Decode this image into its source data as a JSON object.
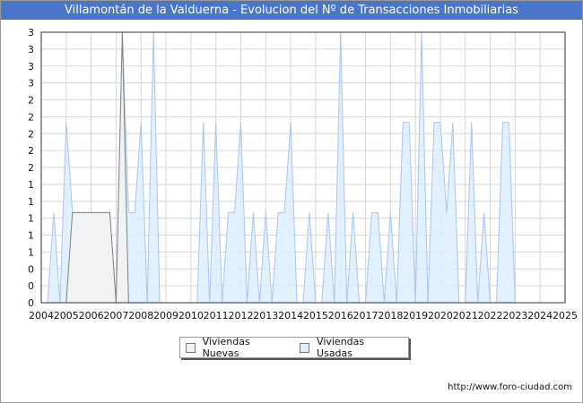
{
  "title": "Villamontán de la Valduerna - Evolucion del Nº de Transacciones Inmobiliarias",
  "footer": "http://www.foro-ciudad.com",
  "legend": {
    "nuevas_label": "Viviendas Nuevas",
    "usadas_label": "Viviendas Usadas"
  },
  "colors": {
    "title_bg": "#4a76c9",
    "nuevas_fill": "#f2f2f2",
    "nuevas_line": "#808080",
    "usadas_fill": "#ddeeff",
    "usadas_line": "#a9c4ee",
    "grid": "#d6d6d6"
  },
  "chart_data": {
    "type": "area",
    "title": "Villamontán de la Valduerna - Evolucion del Nº de Transacciones Inmobiliarias",
    "xlabel": "",
    "ylabel": "",
    "grid": true,
    "legend_position": "bottom-center",
    "xlim": [
      2004,
      2025
    ],
    "ylim": [
      0,
      3
    ],
    "x_ticks": [
      "2004",
      "2005",
      "2006",
      "2007",
      "2008",
      "2009",
      "2010",
      "2011",
      "2012",
      "2013",
      "2014",
      "2015",
      "2016",
      "2017",
      "2018",
      "2019",
      "2020",
      "2021",
      "2022",
      "2023",
      "2024",
      "2025"
    ],
    "y_ticks": [
      "0",
      "0",
      "0",
      "1",
      "1",
      "1",
      "1",
      "1",
      "2",
      "2",
      "2",
      "2",
      "2",
      "3",
      "3",
      "3",
      "3"
    ],
    "x": [
      2004,
      2004.25,
      2004.5,
      2004.75,
      2005,
      2005.25,
      2005.5,
      2005.75,
      2006,
      2006.25,
      2006.5,
      2006.75,
      2007,
      2007.25,
      2007.5,
      2007.75,
      2008,
      2008.25,
      2008.5,
      2008.75,
      2009,
      2009.25,
      2009.5,
      2009.75,
      2010,
      2010.25,
      2010.5,
      2010.75,
      2011,
      2011.25,
      2011.5,
      2011.75,
      2012,
      2012.25,
      2012.5,
      2012.75,
      2013,
      2013.25,
      2013.5,
      2013.75,
      2014,
      2014.25,
      2014.5,
      2014.75,
      2015,
      2015.25,
      2015.5,
      2015.75,
      2016,
      2016.25,
      2016.5,
      2016.75,
      2017,
      2017.25,
      2017.5,
      2017.75,
      2018,
      2018.25,
      2018.5,
      2018.75,
      2019,
      2019.25,
      2019.5,
      2019.75,
      2020,
      2020.25,
      2020.5,
      2020.75,
      2021,
      2021.25,
      2021.5,
      2021.75,
      2022,
      2022.25,
      2022.5,
      2022.75,
      2023,
      2023.25,
      2023.5,
      2023.75,
      2024,
      2024.25,
      2024.5,
      2024.75,
      2025
    ],
    "series": [
      {
        "name": "Viviendas Nuevas",
        "values": [
          0,
          0,
          0,
          0,
          0,
          1,
          1,
          1,
          1,
          1,
          1,
          1,
          0,
          3,
          0,
          0,
          0,
          0,
          0,
          0,
          0,
          0,
          0,
          0,
          0,
          0,
          0,
          0,
          0,
          0,
          0,
          0,
          0,
          0,
          0,
          0,
          0,
          0,
          0,
          0,
          0,
          0,
          0,
          0,
          0,
          0,
          0,
          0,
          0,
          0,
          0,
          0,
          0,
          0,
          0,
          0,
          0,
          0,
          0,
          0,
          0,
          0,
          0,
          0,
          0,
          0,
          0,
          0,
          0,
          0,
          0,
          0,
          0,
          0,
          0,
          0,
          0,
          0,
          0,
          0,
          0,
          0,
          0,
          0,
          0
        ]
      },
      {
        "name": "Viviendas Usadas",
        "values": [
          0,
          0,
          1,
          0,
          2,
          1,
          1,
          1,
          1,
          1,
          1,
          1,
          0,
          3,
          1,
          1,
          2,
          0,
          3,
          0,
          0,
          0,
          0,
          0,
          0,
          0,
          2,
          0,
          2,
          0,
          1,
          1,
          2,
          0,
          1,
          0,
          1,
          0,
          1,
          1,
          2,
          0,
          0,
          1,
          0,
          0,
          1,
          0,
          3,
          0,
          1,
          0,
          0,
          1,
          1,
          0,
          1,
          0,
          2,
          2,
          0,
          3,
          0,
          2,
          2,
          1,
          2,
          0,
          0,
          2,
          0,
          1,
          0,
          0,
          2,
          2
        ]
      }
    ]
  }
}
